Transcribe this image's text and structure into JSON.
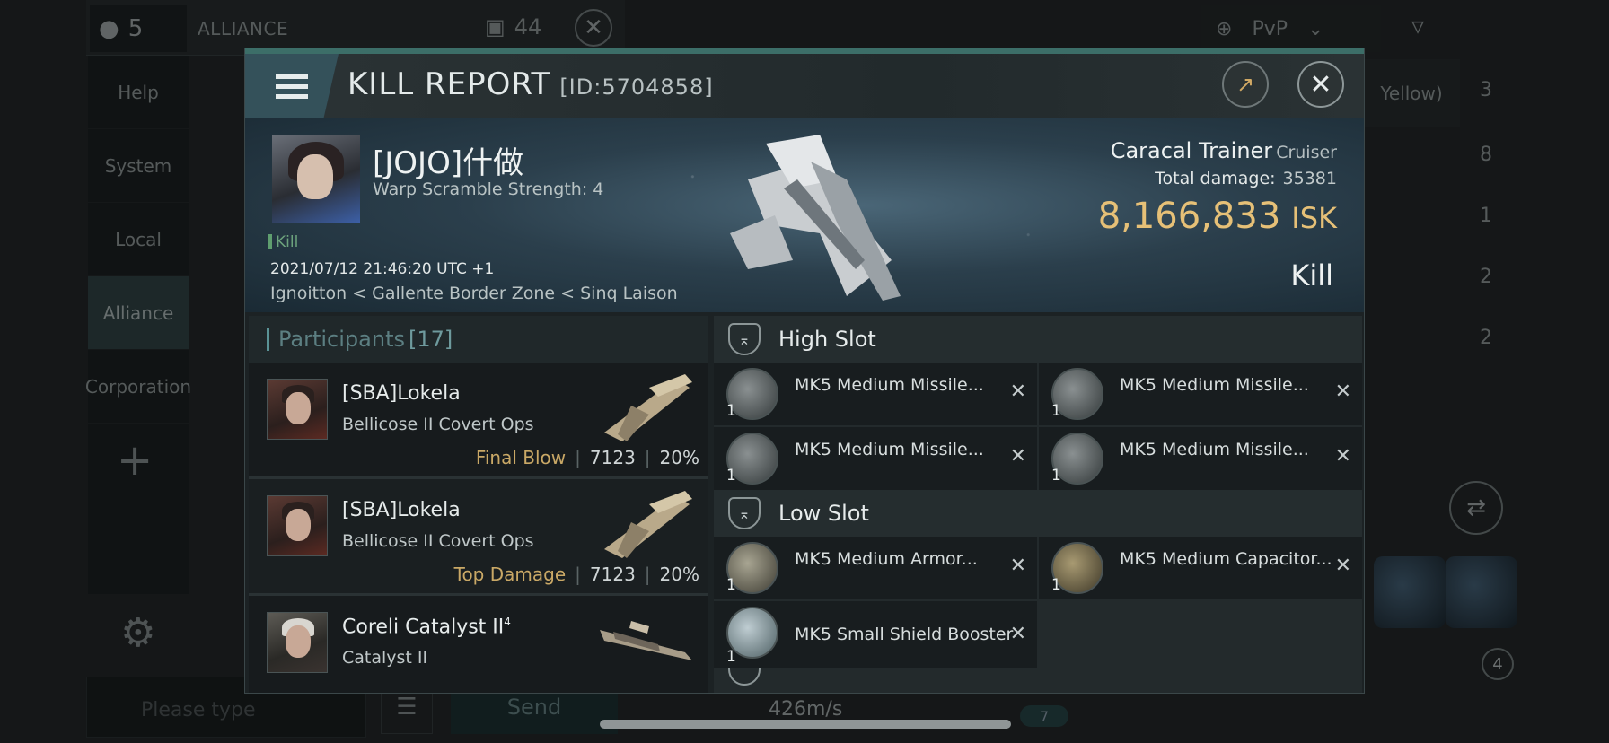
{
  "background": {
    "member_count": "5",
    "channel_label": "ALLIANCE",
    "channel_count": "44",
    "sidebar": [
      "Help",
      "System",
      "Local",
      "Alliance",
      "Corporation"
    ],
    "active_channel": "Alliance",
    "input_placeholder": "Please type",
    "send_label": "Send",
    "filter_label": "PvP",
    "standing_label": "Yellow)",
    "right_counts": [
      "3",
      "8",
      "1",
      "2",
      "2"
    ],
    "speed": "426m/s",
    "drone_count": "4",
    "bottom_count": "7"
  },
  "modal": {
    "title": "KILL REPORT",
    "report_id": "[ID:5704858]",
    "victim": {
      "name": "[JOJO]什做",
      "warp_scramble": "Warp Scramble Strength: 4",
      "kill_tag": "Kill",
      "datetime": "2021/07/12 21:46:20 UTC +1",
      "location": "Ignoitton < Gallente Border Zone < Sinq Laison"
    },
    "ship": {
      "name": "Caracal Trainer",
      "class": "Cruiser",
      "total_damage_label": "Total damage:",
      "total_damage": "35381",
      "isk_value": "8,166,833",
      "isk_unit": "ISK",
      "result": "Kill"
    },
    "participants": {
      "label": "Participants",
      "count": "[17]",
      "rows": [
        {
          "name": "[SBA]Lokela",
          "ship": "Bellicose II Covert Ops",
          "tag": "Final Blow",
          "damage": "7123",
          "percent": "20%"
        },
        {
          "name": "[SBA]Lokela",
          "ship": "Bellicose II Covert Ops",
          "tag": "Top Damage",
          "damage": "7123",
          "percent": "20%"
        },
        {
          "name": "Coreli Catalyst II",
          "name_sup": "4",
          "ship": "Catalyst II",
          "tag": "",
          "damage": "",
          "percent": ""
        }
      ]
    },
    "fitting": {
      "high_slot_label": "High Slot",
      "high_slot": [
        {
          "name": "MK5 Medium Missile...",
          "qty": "1"
        },
        {
          "name": "MK5 Medium Missile...",
          "qty": "1"
        },
        {
          "name": "MK5 Medium Missile...",
          "qty": "1"
        },
        {
          "name": "MK5 Medium Missile...",
          "qty": "1"
        }
      ],
      "low_slot_label": "Low Slot",
      "low_slot": [
        {
          "name": "MK5 Medium Armor...",
          "qty": "1"
        },
        {
          "name": "MK5 Medium Capacitor...",
          "qty": "1"
        },
        {
          "name": "MK5 Small Shield Booster",
          "qty": "1"
        }
      ]
    }
  }
}
